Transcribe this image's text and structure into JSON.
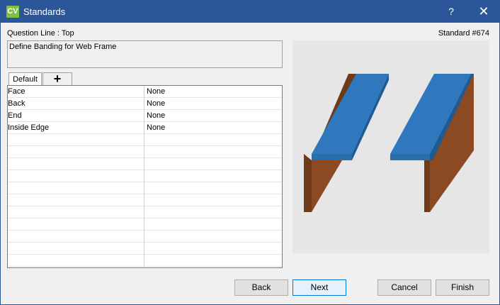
{
  "window": {
    "app_icon_text": "CV",
    "title": "Standards",
    "help_glyph": "?",
    "close_glyph": "✕"
  },
  "header": {
    "question_line": "Question Line : Top",
    "standard_number": "Standard #674"
  },
  "description": "Define Banding for Web Frame",
  "tabs": [
    {
      "label": "Default"
    },
    {
      "label": "+"
    }
  ],
  "grid": {
    "rows": [
      {
        "name": "Face",
        "value": "None"
      },
      {
        "name": "Back",
        "value": "None"
      },
      {
        "name": "End",
        "value": "None"
      },
      {
        "name": "Inside Edge",
        "value": "None"
      }
    ],
    "empty_row_count": 11
  },
  "preview": {
    "image": "web-frame-banding-diagram",
    "colors": {
      "wood_face": "#8b4a22",
      "wood_dark": "#6e3a19",
      "banding_top": "#2f78bd",
      "banding_edge": "#1f5a93",
      "background": "#e6e6e6"
    }
  },
  "buttons": {
    "back": "Back",
    "next": "Next",
    "cancel": "Cancel",
    "finish": "Finish"
  },
  "colors": {
    "titlebar": "#2b579a",
    "app_icon": "#7dc142"
  }
}
